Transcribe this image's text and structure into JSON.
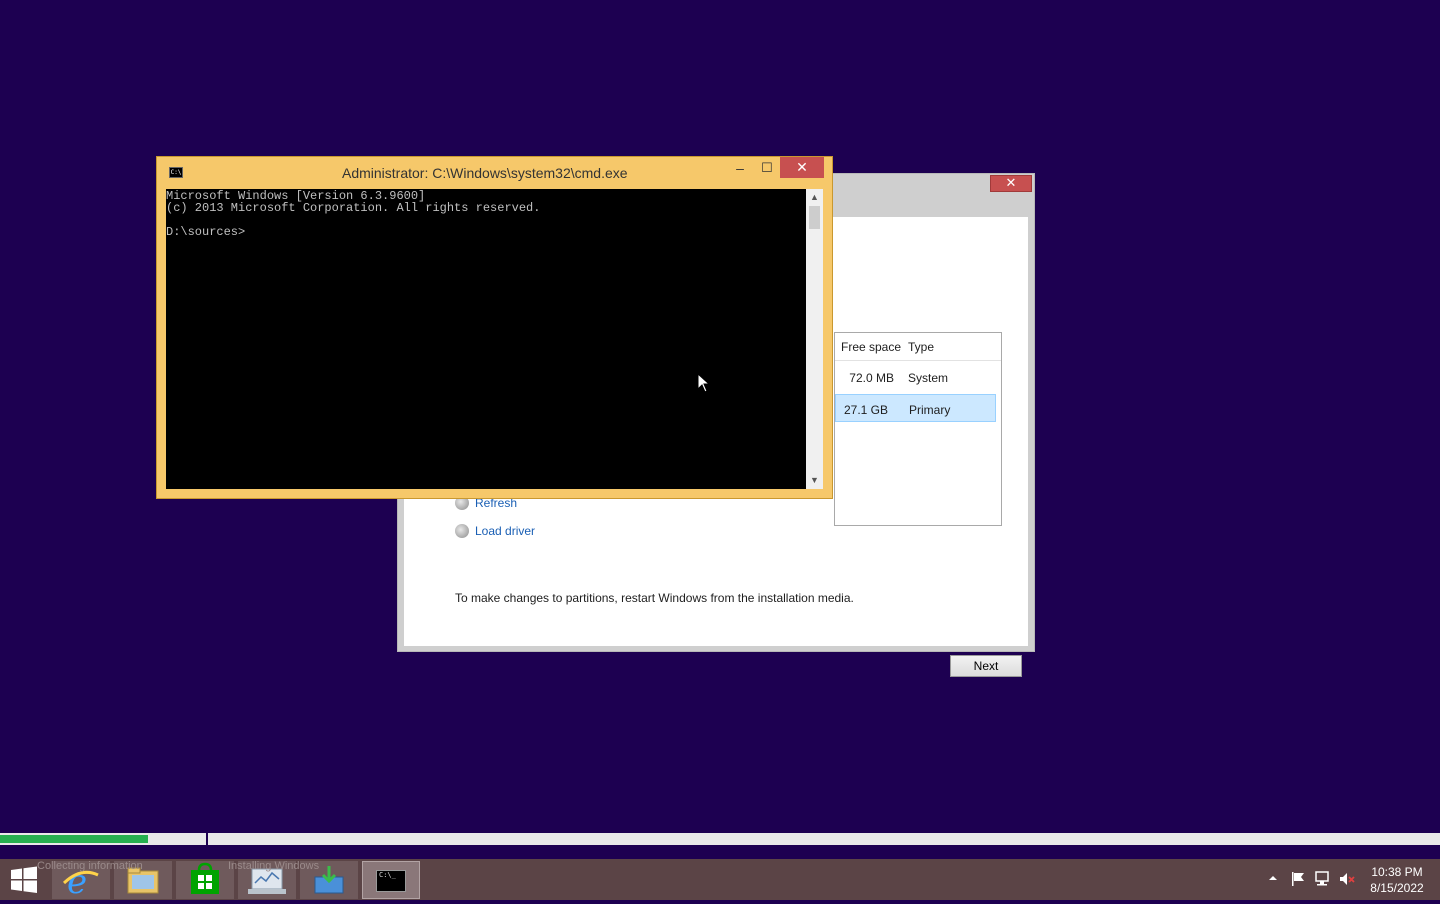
{
  "setup_dialog": {
    "close_glyph": "✕",
    "columns": {
      "free_space": "Free space",
      "type": "Type"
    },
    "partitions": [
      {
        "free": "72.0 MB",
        "type": "System",
        "selected": false
      },
      {
        "free": "27.1 GB",
        "type": "Primary",
        "selected": true
      }
    ],
    "refresh_label": "Refresh",
    "load_driver_label": "Load driver",
    "note": "To make changes to partitions, restart Windows from the installation media.",
    "next_label": "Next"
  },
  "cmd_window": {
    "title": "Administrator: C:\\Windows\\system32\\cmd.exe",
    "app_icon_text": "C:\\",
    "minimize_glyph": "–",
    "maximize_glyph": "☐",
    "close_glyph": "✕",
    "console_text": "Microsoft Windows [Version 6.3.9600]\n(c) 2013 Microsoft Corporation. All rights reserved.\n\nD:\\sources>"
  },
  "progress": {
    "step1_label": "Collecting information",
    "step2_label": "Installing Windows",
    "step1_fraction": 0.72
  },
  "taskbar": {
    "buttons": [
      {
        "name": "internet-explorer",
        "icon": "ie-icon"
      },
      {
        "name": "file-explorer",
        "icon": "folder-icon"
      },
      {
        "name": "store",
        "icon": "store-icon"
      },
      {
        "name": "setup-monitor",
        "icon": "monitor-icon"
      },
      {
        "name": "windows-setup",
        "icon": "setup-icon"
      },
      {
        "name": "command-prompt",
        "icon": "cmd-icon",
        "active": true
      }
    ],
    "cmd_icon_text": "C:\\_",
    "time": "10:38 PM",
    "date": "8/15/2022"
  },
  "colors": {
    "desktop": "#1d0051",
    "cmd_frame": "#f6c86a",
    "close_red": "#c75050",
    "progress_green": "#26b050",
    "taskbar": "#5b4446"
  }
}
